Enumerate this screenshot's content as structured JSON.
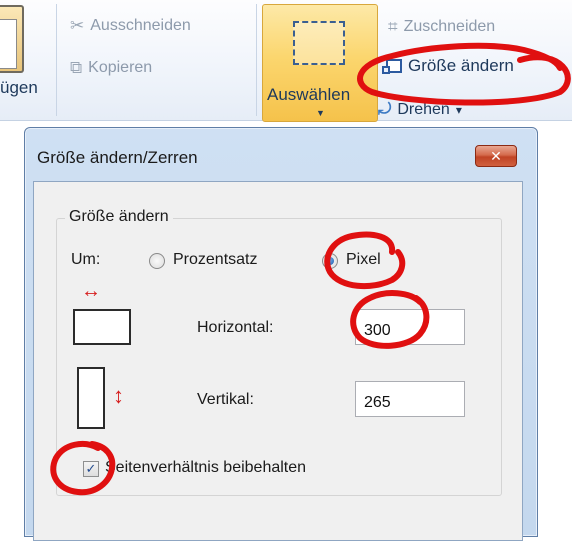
{
  "ribbon": {
    "paste_label": "ügen",
    "ausschneiden_label": "Ausschneiden",
    "kopieren_label": "Kopieren",
    "auswaehlen_label": "Auswählen",
    "zuschneiden_label": "Zuschneiden",
    "groesse_aendern_label": "Größe ändern",
    "drehen_label": "Drehen",
    "drehen_arrow": "▾",
    "auswaehlen_arrow": "▼"
  },
  "dialog": {
    "title": "Größe ändern/Zerren",
    "close_glyph": "✕",
    "group_title": "Größe ändern",
    "um_label": "Um:",
    "radio_percent_label": "Prozentsatz",
    "radio_pixel_label": "Pixel",
    "selected_unit": "Pixel",
    "horizontal_label": "Horizontal:",
    "horizontal_value": "300",
    "vertical_label": "Vertikal:",
    "vertical_value": "265",
    "aspect_checkbox_label": "Seitenverhältnis beibehalten",
    "aspect_checked": true,
    "check_glyph": "✓",
    "h_arrow": "↔",
    "v_arrow": "↕"
  },
  "colors": {
    "annotation_red": "#e01010",
    "dialog_frame": "#c4d8ee",
    "ribbon_highlight": "#fbd66e"
  }
}
